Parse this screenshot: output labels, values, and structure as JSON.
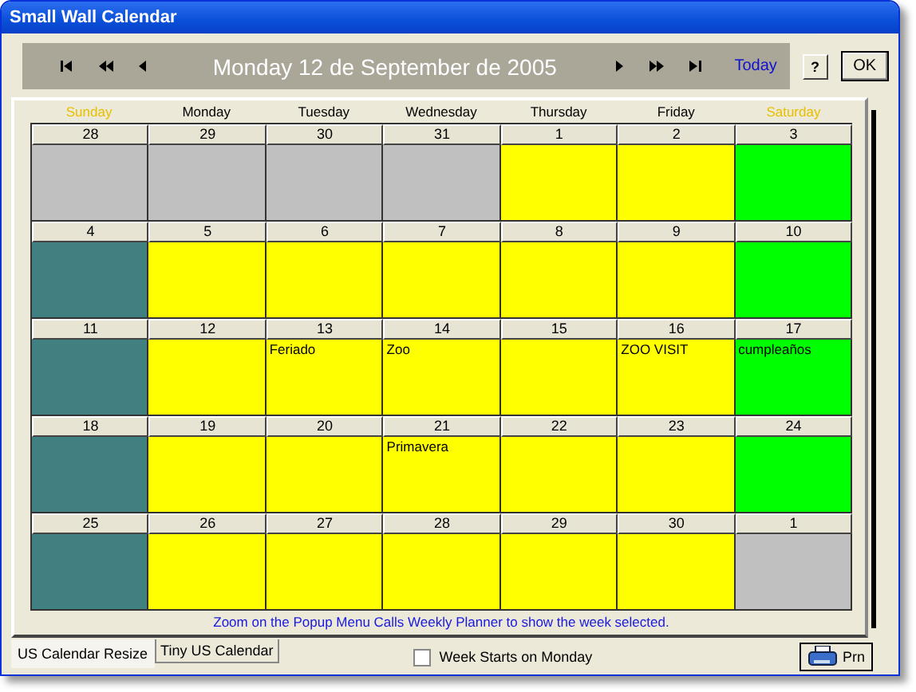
{
  "window": {
    "title": "Small Wall Calendar"
  },
  "header": {
    "date": "Monday 12 de September de 2005",
    "today": "Today",
    "help": "?",
    "ok": "OK"
  },
  "weekdays": [
    {
      "label": "Sunday",
      "color": "#e8c000"
    },
    {
      "label": "Monday",
      "color": "#000000"
    },
    {
      "label": "Tuesday",
      "color": "#000000"
    },
    {
      "label": "Wednesday",
      "color": "#000000"
    },
    {
      "label": "Thursday",
      "color": "#000000"
    },
    {
      "label": "Friday",
      "color": "#000000"
    },
    {
      "label": "Saturday",
      "color": "#e8c000"
    }
  ],
  "days": [
    {
      "day": "28",
      "color": "#c0c0c0"
    },
    {
      "day": "29",
      "color": "#c0c0c0"
    },
    {
      "day": "30",
      "color": "#c0c0c0"
    },
    {
      "day": "31",
      "color": "#c0c0c0"
    },
    {
      "day": "1",
      "color": "#ffff00"
    },
    {
      "day": "2",
      "color": "#ffff00"
    },
    {
      "day": "3",
      "color": "#00ff00"
    },
    {
      "day": "4",
      "color": "#408080"
    },
    {
      "day": "5",
      "color": "#ffff00"
    },
    {
      "day": "6",
      "color": "#ffff00"
    },
    {
      "day": "7",
      "color": "#ffff00"
    },
    {
      "day": "8",
      "color": "#ffff00"
    },
    {
      "day": "9",
      "color": "#ffff00"
    },
    {
      "day": "10",
      "color": "#00ff00"
    },
    {
      "day": "11",
      "color": "#408080"
    },
    {
      "day": "12",
      "color": "#ffff00"
    },
    {
      "day": "13",
      "color": "#ffff00",
      "event": "Feriado"
    },
    {
      "day": "14",
      "color": "#ffff00",
      "event": "Zoo"
    },
    {
      "day": "15",
      "color": "#ffff00"
    },
    {
      "day": "16",
      "color": "#ffff00",
      "event": "ZOO VISIT"
    },
    {
      "day": "17",
      "color": "#00ff00",
      "event": "cumpleaños"
    },
    {
      "day": "18",
      "color": "#408080"
    },
    {
      "day": "19",
      "color": "#ffff00"
    },
    {
      "day": "20",
      "color": "#ffff00"
    },
    {
      "day": "21",
      "color": "#ffff00",
      "event": "Primavera"
    },
    {
      "day": "22",
      "color": "#ffff00"
    },
    {
      "day": "23",
      "color": "#ffff00"
    },
    {
      "day": "24",
      "color": "#00ff00"
    },
    {
      "day": "25",
      "color": "#408080"
    },
    {
      "day": "26",
      "color": "#ffff00"
    },
    {
      "day": "27",
      "color": "#ffff00"
    },
    {
      "day": "28",
      "color": "#ffff00"
    },
    {
      "day": "29",
      "color": "#ffff00"
    },
    {
      "day": "30",
      "color": "#ffff00"
    },
    {
      "day": "1",
      "color": "#c0c0c0"
    }
  ],
  "note": "Zoom on the Popup Menu Calls Weekly Planner to show the week selected.",
  "tabs": [
    {
      "label": "US Calendar Resize",
      "selected": true
    },
    {
      "label": "Tiny US Calendar",
      "selected": false
    }
  ],
  "week_starts_monday": {
    "label": "Week Starts on Monday",
    "checked": false
  },
  "print": {
    "label": "Prn"
  }
}
